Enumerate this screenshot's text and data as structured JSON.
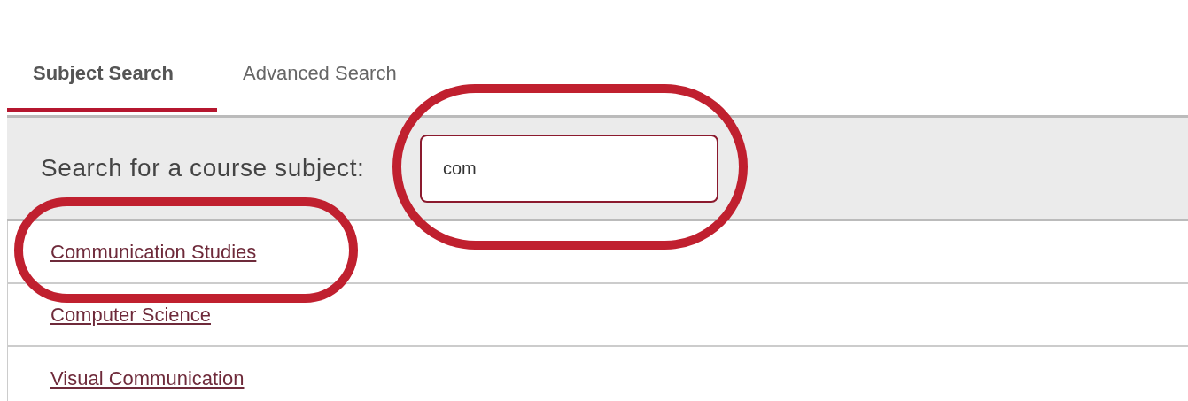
{
  "tabs": [
    {
      "label": "Subject Search",
      "selected": true
    },
    {
      "label": "Advanced Search",
      "selected": false
    }
  ],
  "search": {
    "label": "Search for a course subject:",
    "value": "com"
  },
  "results": [
    {
      "label": "Communication Studies"
    },
    {
      "label": "Computer Science"
    },
    {
      "label": "Visual Communication"
    }
  ]
}
